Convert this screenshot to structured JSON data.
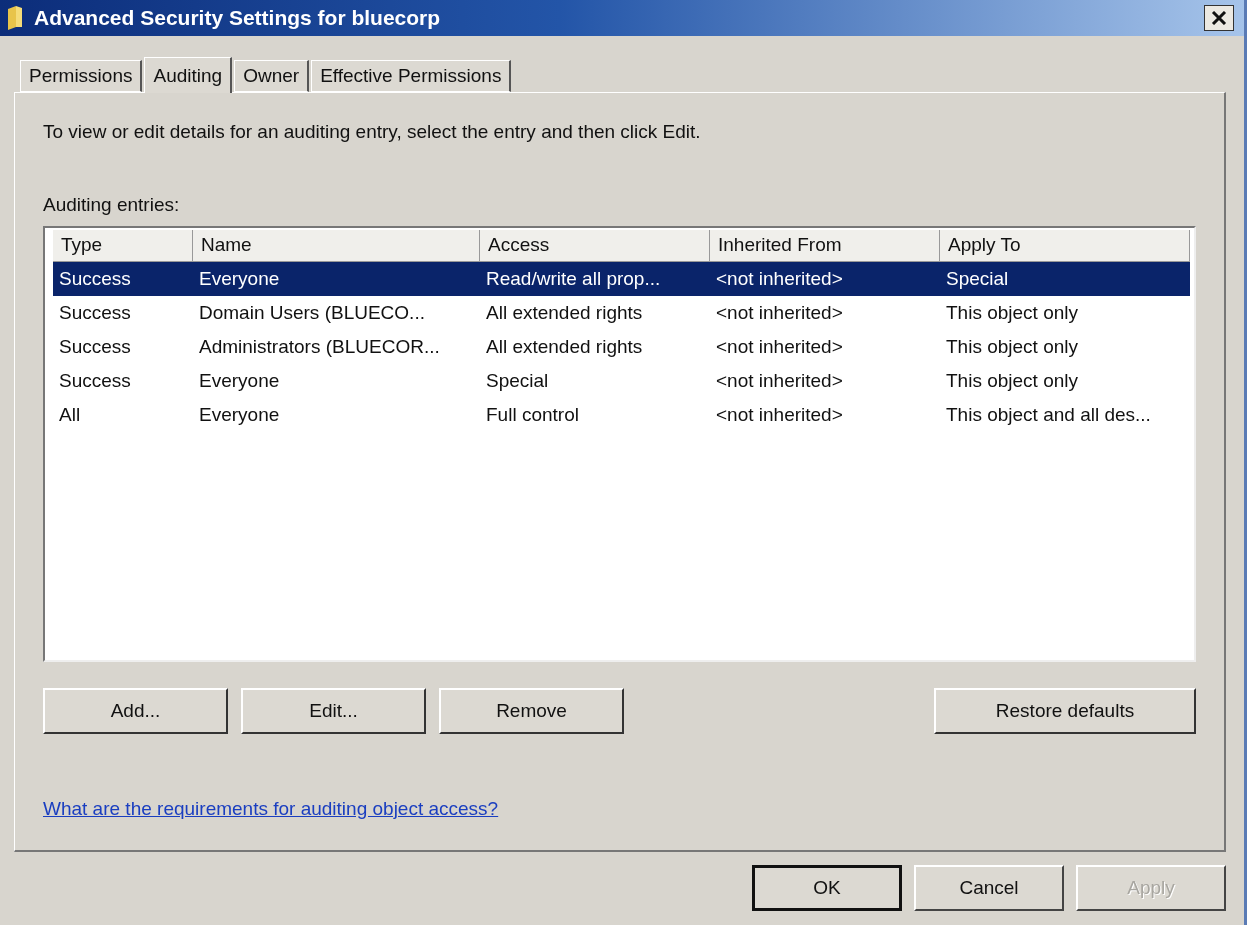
{
  "window": {
    "title": "Advanced Security Settings for bluecorp"
  },
  "tabs": [
    {
      "label": "Permissions",
      "selected": false
    },
    {
      "label": "Auditing",
      "selected": true
    },
    {
      "label": "Owner",
      "selected": false
    },
    {
      "label": "Effective Permissions",
      "selected": false
    }
  ],
  "instruction": "To view or edit details for an auditing entry, select the entry and then click Edit.",
  "table": {
    "label": "Auditing entries:",
    "columns": [
      "Type",
      "Name",
      "Access",
      "Inherited From",
      "Apply To"
    ],
    "rows": [
      {
        "selected": true,
        "cells": [
          "Success",
          "Everyone",
          "Read/write all prop...",
          "<not inherited>",
          "Special"
        ]
      },
      {
        "selected": false,
        "cells": [
          "Success",
          "Domain Users (BLUECO...",
          "All extended rights",
          "<not inherited>",
          "This object only"
        ]
      },
      {
        "selected": false,
        "cells": [
          "Success",
          "Administrators (BLUECOR...",
          "All extended rights",
          "<not inherited>",
          "This object only"
        ]
      },
      {
        "selected": false,
        "cells": [
          "Success",
          "Everyone",
          "Special",
          "<not inherited>",
          "This object only"
        ]
      },
      {
        "selected": false,
        "cells": [
          "All",
          "Everyone",
          "Full control",
          "<not inherited>",
          "This object and all des..."
        ]
      }
    ]
  },
  "entry_buttons": [
    "Add...",
    "Edit...",
    "Remove"
  ],
  "restore_button": "Restore defaults",
  "help_link": "What are the requirements for auditing object access?",
  "dialog_buttons": [
    {
      "label": "OK",
      "default": true,
      "disabled": false
    },
    {
      "label": "Cancel",
      "default": false,
      "disabled": false
    },
    {
      "label": "Apply",
      "default": false,
      "disabled": true
    }
  ]
}
